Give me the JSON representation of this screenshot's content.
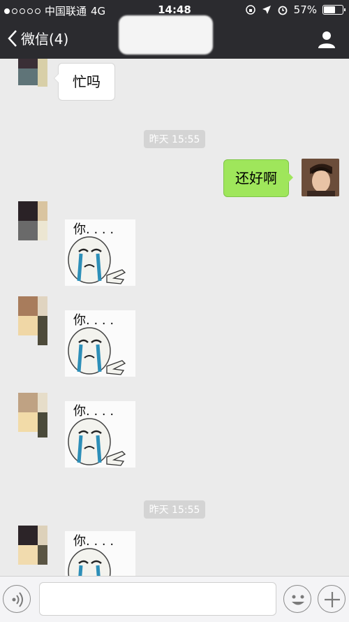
{
  "status_bar": {
    "carrier": "中国联通",
    "network": "4G",
    "time": "14:48",
    "battery_percent": "57%",
    "battery_level": 0.57
  },
  "nav": {
    "back_label": "微信(4)"
  },
  "messages": {
    "m1_text": "忙吗",
    "timestamp1": "昨天 15:55",
    "m2_text": "还好啊",
    "timestamp2": "昨天 15:55"
  },
  "sticker": {
    "caption": "你. . . ."
  },
  "colors": {
    "header_bg": "#2b2b2f",
    "chat_bg": "#ebebeb",
    "sent_bubble": "#9fe65b",
    "received_bubble": "#ffffff"
  }
}
